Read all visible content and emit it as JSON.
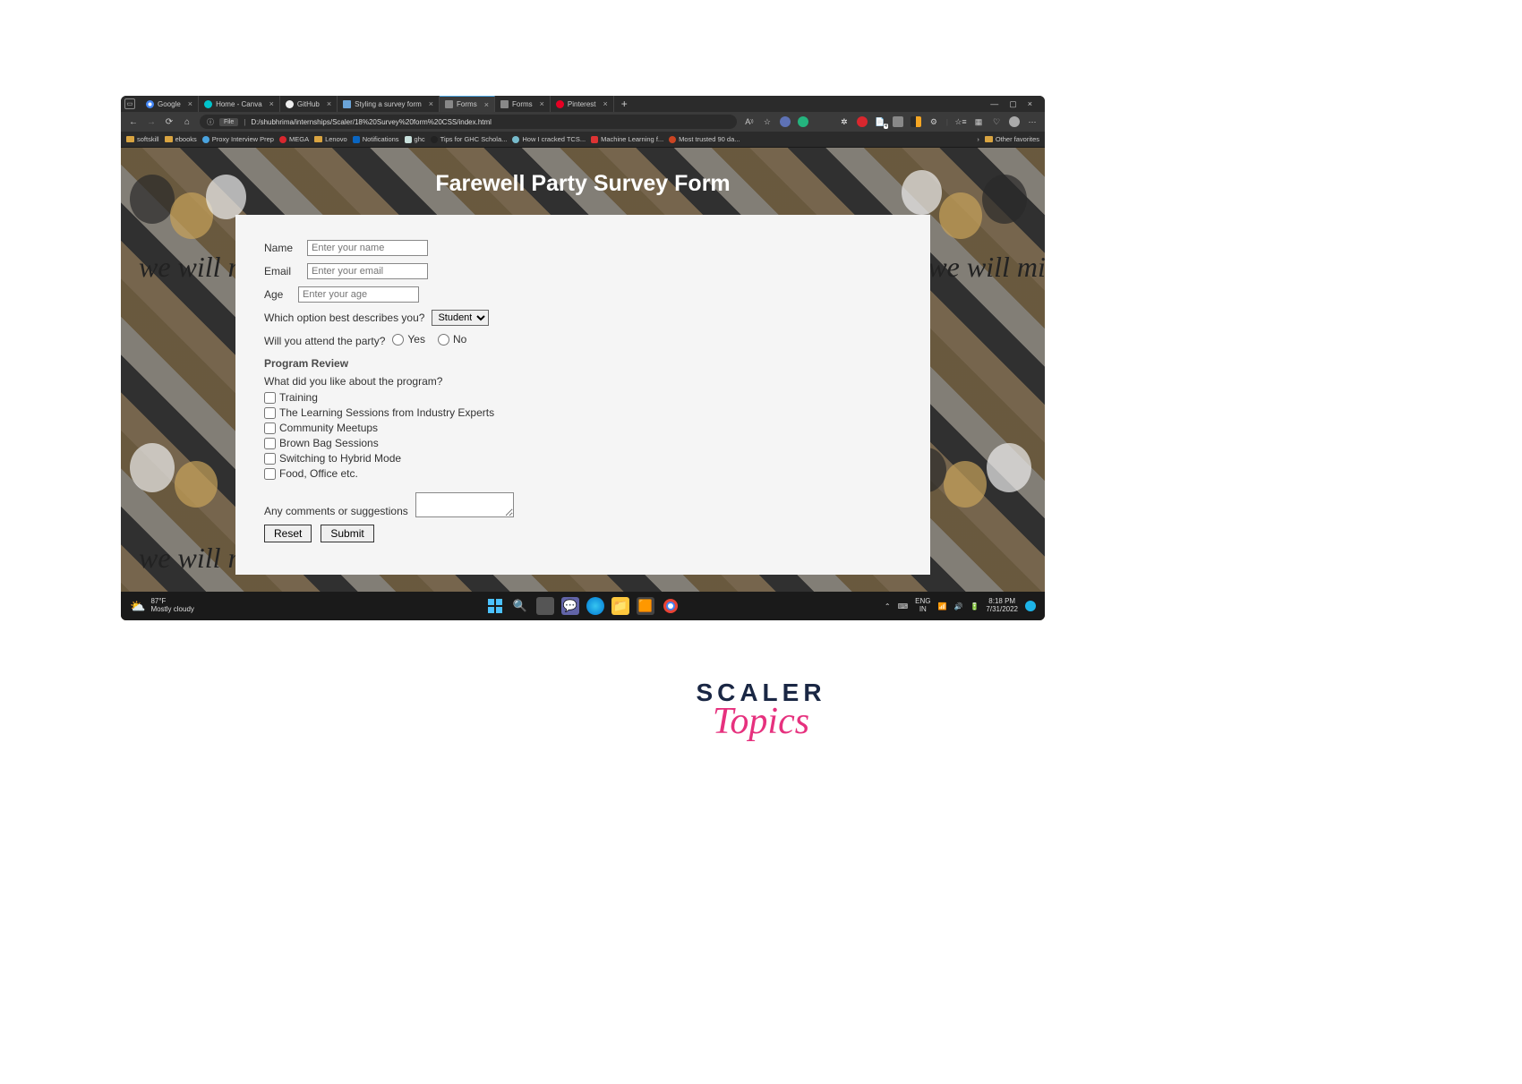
{
  "tabs": [
    {
      "label": "Google",
      "favicon_color": "#4285f4"
    },
    {
      "label": "Home - Canva",
      "favicon_color": "#00c4cc"
    },
    {
      "label": "GitHub",
      "favicon_color": "#f5f5f5"
    },
    {
      "label": "Styling a survey form",
      "favicon_color": "#6ba4d8"
    },
    {
      "label": "Forms",
      "favicon_color": "#888"
    },
    {
      "label": "Forms",
      "favicon_color": "#888"
    },
    {
      "label": "Pinterest",
      "favicon_color": "#e60023"
    }
  ],
  "active_tab_index": 4,
  "url_prefix": "File",
  "url_info_icon": "ⓘ",
  "url": "D:/shubhrima/internships/Scaler/18%20Survey%20form%20CSS/index.html",
  "bookmarks": [
    {
      "label": "softskill",
      "type": "folder"
    },
    {
      "label": "ebooks",
      "type": "folder"
    },
    {
      "label": "Proxy Interview Prep",
      "type": "icon",
      "color": "#4aa3df"
    },
    {
      "label": "MEGA",
      "type": "icon",
      "color": "#d9272e"
    },
    {
      "label": "Lenovo",
      "type": "folder"
    },
    {
      "label": "Notifications",
      "type": "icon",
      "color": "#0a66c2"
    },
    {
      "label": "ghc",
      "type": "icon",
      "color": "#7aa"
    },
    {
      "label": "Tips for GHC Schola...",
      "type": "icon",
      "color": "#222"
    },
    {
      "label": "How I cracked TCS...",
      "type": "icon",
      "color": "#7bc"
    },
    {
      "label": "Machine Learning f...",
      "type": "icon",
      "color": "#d33"
    },
    {
      "label": "Most trusted 90 da...",
      "type": "icon",
      "color": "#c42"
    }
  ],
  "other_favorites_label": "Other favorites",
  "page": {
    "title": "Farewell Party Survey Form",
    "bg_text": "we will miss you",
    "name_label": "Name",
    "name_placeholder": "Enter your name",
    "email_label": "Email",
    "email_placeholder": "Enter your email",
    "age_label": "Age",
    "age_placeholder": "Enter your age",
    "describe_label": "Which option best describes you?",
    "describe_value": "Student",
    "attend_label": "Will you attend the party?",
    "attend_yes": "Yes",
    "attend_no": "No",
    "review_header": "Program Review",
    "like_label": "What did you like about the program?",
    "checkboxes": [
      "Training",
      "The Learning Sessions from Industry Experts",
      "Community Meetups",
      "Brown Bag Sessions",
      "Switching to Hybrid Mode",
      "Food, Office etc."
    ],
    "comments_label": "Any comments or suggestions",
    "reset_label": "Reset",
    "submit_label": "Submit"
  },
  "taskbar": {
    "temp": "87°F",
    "condition": "Mostly cloudy",
    "lang1": "ENG",
    "lang2": "IN",
    "time": "8:18 PM",
    "date": "7/31/2022"
  },
  "brand": {
    "main": "SCALER",
    "sub": "Topics"
  }
}
